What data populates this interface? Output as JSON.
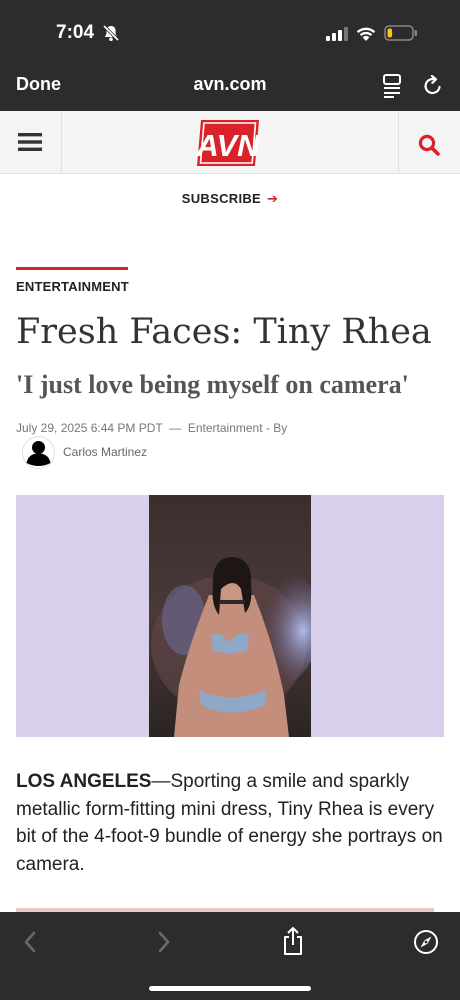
{
  "status_bar": {
    "time": "7:04",
    "battery_level": 0.2
  },
  "browser": {
    "done_label": "Done",
    "url": "avn.com"
  },
  "site": {
    "logo_text": "AVN",
    "subscribe_label": "SUBSCRIBE",
    "subscribe_arrow": "➔"
  },
  "article": {
    "category": "ENTERTAINMENT",
    "title": "Fresh Faces: Tiny Rhea",
    "subtitle": "'I just love being myself on camera'",
    "meta": "July 29, 2025 6:44 PM PDT  —  Entertainment - By",
    "author": "Carlos Martinez",
    "lead_location": "LOS ANGELES",
    "lead_text": "—Sporting a smile and sparkly metallic form-fitting mini dress, Tiny Rhea is every bit of the 4-foot-9 bundle of energy she portrays on camera."
  },
  "icons": {
    "notifications_off": "bell-slash-icon",
    "signal": "cellular-signal-icon",
    "wifi": "wifi-icon",
    "battery": "battery-icon",
    "reader": "reader-view-icon",
    "reload": "reload-icon",
    "menu": "hamburger-menu-icon",
    "search": "search-icon",
    "back": "chevron-left-icon",
    "forward": "chevron-right-icon",
    "share": "share-icon",
    "compass": "compass-icon"
  },
  "colors": {
    "brand_red": "#d8232a",
    "chrome_dark": "#2c2c2e",
    "battery_low": "#f5c518",
    "hero_bg": "#d8cfea"
  }
}
